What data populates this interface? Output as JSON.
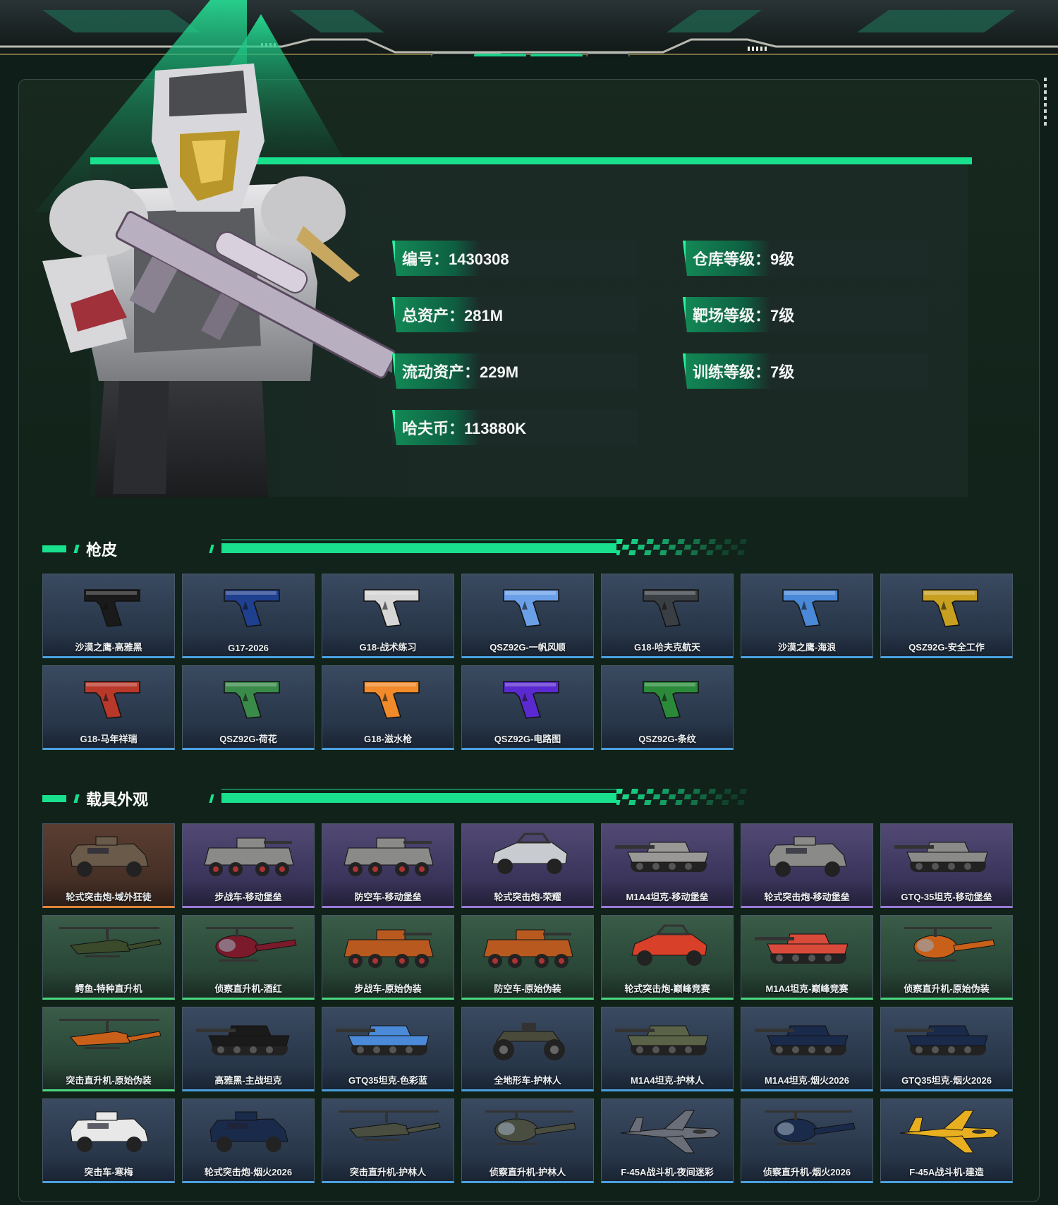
{
  "profile": {
    "stats": [
      {
        "id": "id",
        "text": "编号：1430308"
      },
      {
        "id": "total-assets",
        "text": "总资产：281M"
      },
      {
        "id": "liquid-assets",
        "text": "流动资产：229M"
      },
      {
        "id": "havoc-coins",
        "text": "哈夫币：113880K"
      },
      {
        "id": "warehouse-level",
        "text": "仓库等级：9级"
      },
      {
        "id": "range-level",
        "text": "靶场等级：7级"
      },
      {
        "id": "training-level",
        "text": "训练等级：7级"
      }
    ]
  },
  "colors": {
    "accent": "#19e08d",
    "rarity_blue": "#4aa0e0",
    "rarity_purple": "#9a7ad8",
    "rarity_green": "#4ad880",
    "rarity_orange": "#e0853a"
  },
  "gun_skins": {
    "title": "枪皮",
    "items": [
      {
        "label": "沙漠之鹰-高雅黑",
        "rarity": "blue",
        "icon": "pistol-icon",
        "color": "#1a1a1a"
      },
      {
        "label": "G17-2026",
        "rarity": "blue",
        "icon": "pistol-icon",
        "color": "#1f3f8f"
      },
      {
        "label": "G18-战术练习",
        "rarity": "blue",
        "icon": "pistol-icon",
        "color": "#d6d6d6"
      },
      {
        "label": "QSZ92G-一帆风顺",
        "rarity": "blue",
        "icon": "pistol-icon",
        "color": "#6aa0e8"
      },
      {
        "label": "G18-哈夫克航天",
        "rarity": "blue",
        "icon": "pistol-icon",
        "color": "#3a3f44"
      },
      {
        "label": "沙漠之鹰-海浪",
        "rarity": "blue",
        "icon": "pistol-icon",
        "color": "#4a88d8"
      },
      {
        "label": "QSZ92G-安全工作",
        "rarity": "blue",
        "icon": "pistol-icon",
        "color": "#c8a020"
      },
      {
        "label": "G18-马年祥瑞",
        "rarity": "blue",
        "icon": "pistol-icon",
        "color": "#b8382a"
      },
      {
        "label": "QSZ92G-荷花",
        "rarity": "blue",
        "icon": "pistol-icon",
        "color": "#3a8a4a"
      },
      {
        "label": "G18-滋水枪",
        "rarity": "blue",
        "icon": "pistol-icon",
        "color": "#f08a2a"
      },
      {
        "label": "QSZ92G-电路图",
        "rarity": "blue",
        "icon": "pistol-icon",
        "color": "#5a2ad0"
      },
      {
        "label": "QSZ92G-条纹",
        "rarity": "blue",
        "icon": "pistol-icon",
        "color": "#2a8a3a"
      }
    ]
  },
  "vehicle_skins": {
    "title": "载具外观",
    "items": [
      {
        "label": "轮式突击炮-域外狂徒",
        "rarity": "orange",
        "icon": "armored-car-icon",
        "color": "#6a5a4a"
      },
      {
        "label": "步战车-移动堡垒",
        "rarity": "purple",
        "icon": "ifv-icon",
        "color": "#8a8a88"
      },
      {
        "label": "防空车-移动堡垒",
        "rarity": "purple",
        "icon": "ifv-icon",
        "color": "#8a8a88"
      },
      {
        "label": "轮式突击炮-荣耀",
        "rarity": "purple",
        "icon": "buggy-icon",
        "color": "#c8ccd0"
      },
      {
        "label": "M1A4坦克-移动堡垒",
        "rarity": "purple",
        "icon": "tank-icon",
        "color": "#9a9896"
      },
      {
        "label": "轮式突击炮-移动堡垒",
        "rarity": "purple",
        "icon": "armored-car-icon",
        "color": "#8a8a88"
      },
      {
        "label": "GTQ-35坦克-移动堡垒",
        "rarity": "purple",
        "icon": "tank-icon",
        "color": "#8a8a88"
      },
      {
        "label": "鳄鱼-特种直升机",
        "rarity": "green",
        "icon": "attack-helicopter-icon",
        "color": "#3a4a2a"
      },
      {
        "label": "侦察直升机-酒红",
        "rarity": "green",
        "icon": "scout-helicopter-icon",
        "color": "#7a1a2a"
      },
      {
        "label": "步战车-原始伪装",
        "rarity": "green",
        "icon": "ifv-icon",
        "color": "#b85a20"
      },
      {
        "label": "防空车-原始伪装",
        "rarity": "green",
        "icon": "ifv-icon",
        "color": "#b85a20"
      },
      {
        "label": "轮式突击炮-巅峰竞赛",
        "rarity": "green",
        "icon": "buggy-icon",
        "color": "#d8402a"
      },
      {
        "label": "M1A4坦克-巅峰竞赛",
        "rarity": "green",
        "icon": "tank-icon",
        "color": "#d84a3a"
      },
      {
        "label": "侦察直升机-原始伪装",
        "rarity": "green",
        "icon": "scout-helicopter-icon",
        "color": "#c8601a"
      },
      {
        "label": "突击直升机-原始伪装",
        "rarity": "green",
        "icon": "attack-helicopter-icon",
        "color": "#c8601a"
      },
      {
        "label": "高雅黑-主战坦克",
        "rarity": "blue",
        "icon": "tank-icon",
        "color": "#1a1a1a"
      },
      {
        "label": "GTQ35坦克-色彩蓝",
        "rarity": "blue",
        "icon": "tank-icon",
        "color": "#4a8ad8"
      },
      {
        "label": "全地形车-护林人",
        "rarity": "blue",
        "icon": "atv-icon",
        "color": "#4a4a3a"
      },
      {
        "label": "M1A4坦克-护林人",
        "rarity": "blue",
        "icon": "tank-icon",
        "color": "#5a6248"
      },
      {
        "label": "M1A4坦克-烟火2026",
        "rarity": "blue",
        "icon": "tank-icon",
        "color": "#1a2a4a"
      },
      {
        "label": "GTQ35坦克-烟火2026",
        "rarity": "blue",
        "icon": "tank-icon",
        "color": "#1a2a4a"
      },
      {
        "label": "突击车-寒梅",
        "rarity": "blue",
        "icon": "armored-car-icon",
        "color": "#e8e8e8"
      },
      {
        "label": "轮式突击炮-烟火2026",
        "rarity": "blue",
        "icon": "armored-car-icon",
        "color": "#1a2a4a"
      },
      {
        "label": "突击直升机-护林人",
        "rarity": "blue",
        "icon": "attack-helicopter-icon",
        "color": "#4a4e40"
      },
      {
        "label": "侦察直升机-护林人",
        "rarity": "blue",
        "icon": "scout-helicopter-icon",
        "color": "#4a4e40"
      },
      {
        "label": "F-45A战斗机-夜间迷彩",
        "rarity": "blue",
        "icon": "jet-icon",
        "color": "#6a6e78"
      },
      {
        "label": "侦察直升机-烟火2026",
        "rarity": "blue",
        "icon": "scout-helicopter-icon",
        "color": "#1a2a4a"
      },
      {
        "label": "F-45A战斗机-建造",
        "rarity": "blue",
        "icon": "jet-icon",
        "color": "#e8b020"
      }
    ]
  }
}
